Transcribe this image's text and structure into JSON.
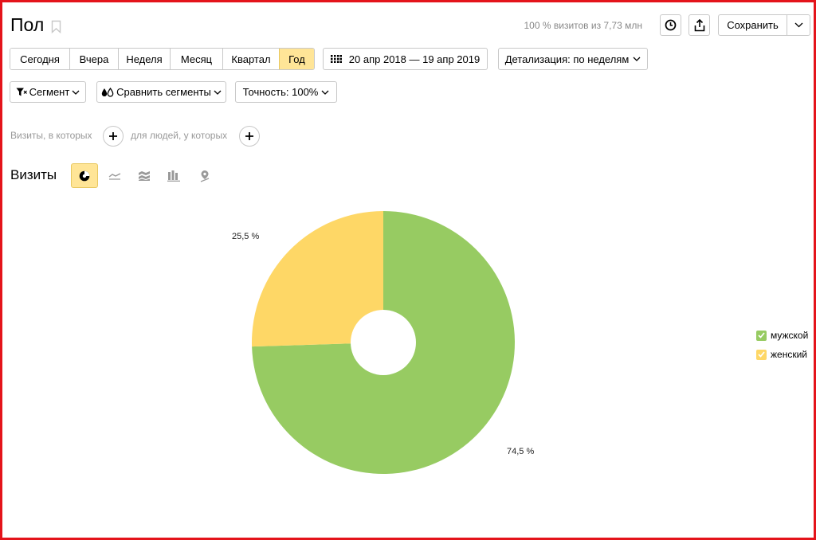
{
  "report": {
    "title": "Пол",
    "summary": "100 % визитов из 7,73 млн",
    "save_label": "Сохранить"
  },
  "periods": [
    {
      "label": "Сегодня",
      "active": false
    },
    {
      "label": "Вчера",
      "active": false
    },
    {
      "label": "Неделя",
      "active": false
    },
    {
      "label": "Месяц",
      "active": false
    },
    {
      "label": "Квартал",
      "active": false
    },
    {
      "label": "Год",
      "active": true
    }
  ],
  "date_range": "20 апр 2018 — 19 апр 2019",
  "detalization": "Детализация: по неделям",
  "filters": {
    "segment": "Сегмент",
    "compare": "Сравнить сегменты",
    "accuracy": "Точность: 100%"
  },
  "conditions": {
    "visits": "Визиты, в которых",
    "people": "для людей, у которых"
  },
  "chart_section": {
    "metric_label": "Визиты",
    "chart_types": [
      "pie-chart-icon",
      "line-chart-icon",
      "area-chart-icon",
      "bar-chart-icon",
      "map-chart-icon"
    ],
    "active_type": "pie-chart-icon"
  },
  "colors": {
    "male": "#97cb62",
    "female": "#fed766",
    "accent": "#ffe597",
    "frame": "#e4141b"
  },
  "chart_data": {
    "type": "pie",
    "donut": true,
    "categories": [
      "мужской",
      "женский"
    ],
    "values": [
      74.5,
      25.5
    ],
    "labels": [
      "74,5 %",
      "25,5 %"
    ],
    "legend": "right"
  }
}
